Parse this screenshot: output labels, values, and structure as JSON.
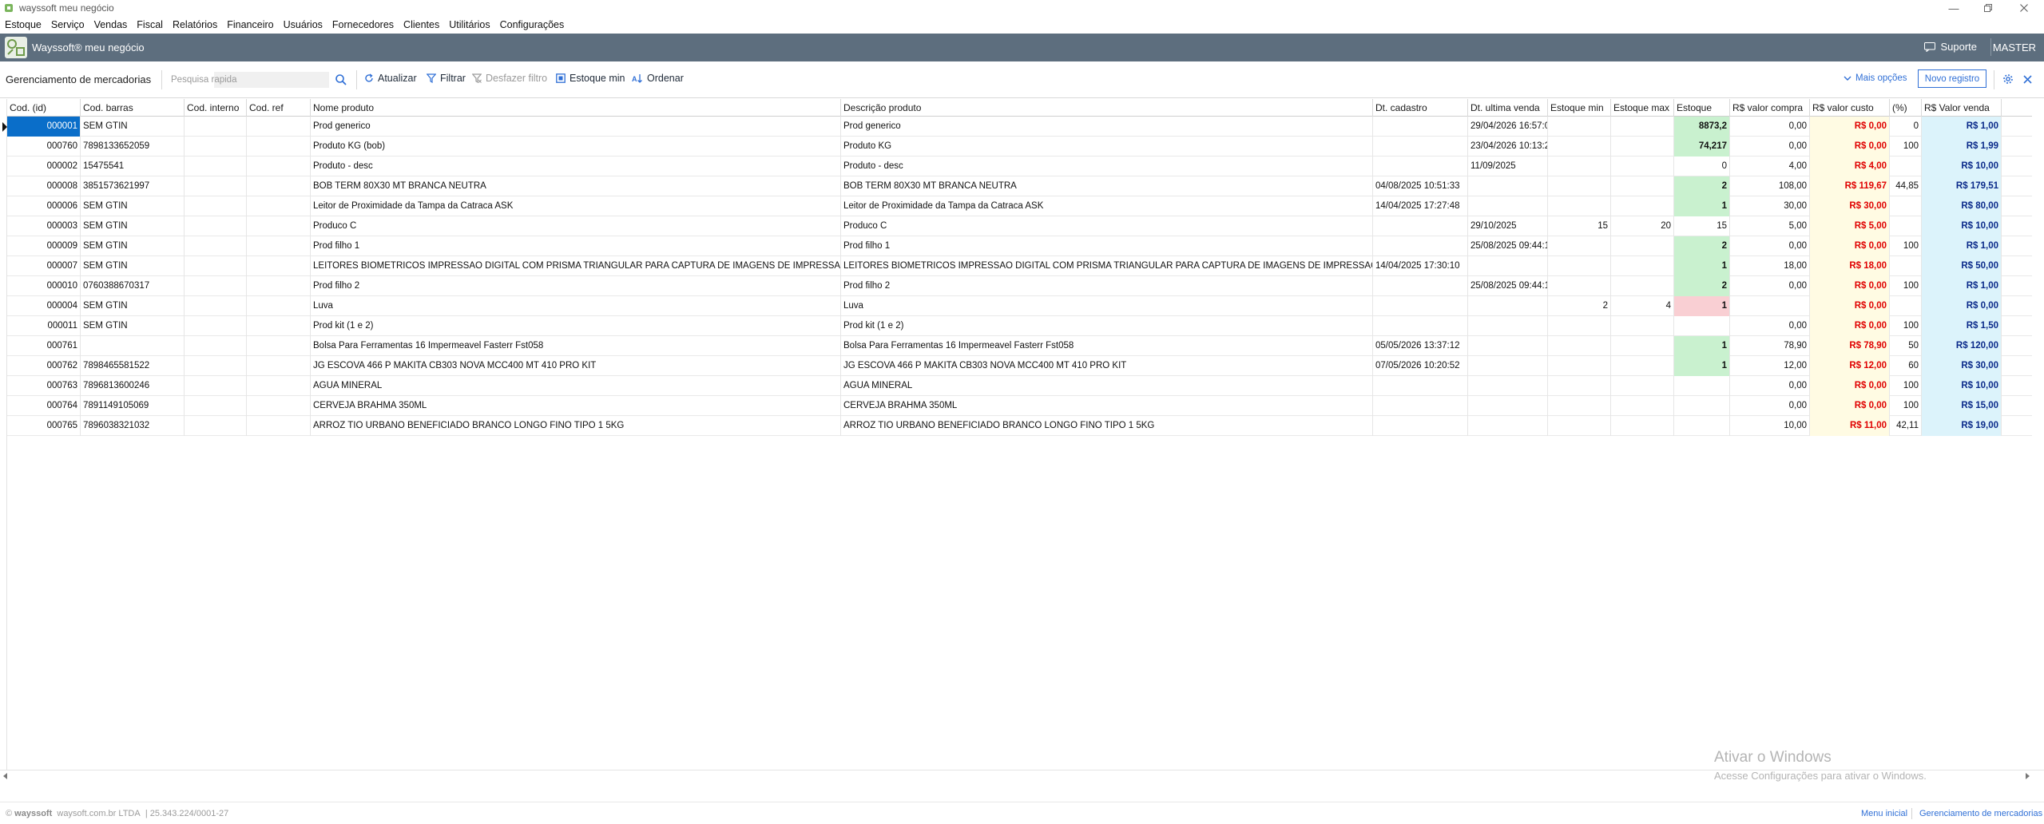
{
  "window": {
    "title": "wayssoft meu negócio"
  },
  "menu": [
    "Estoque",
    "Serviço",
    "Vendas",
    "Fiscal",
    "Relatórios",
    "Financeiro",
    "Usuários",
    "Fornecedores",
    "Clientes",
    "Utilitários",
    "Configurações"
  ],
  "brand": {
    "name": "Wayssoft® meu negócio",
    "support": "Suporte",
    "user": "MASTER"
  },
  "toolbar": {
    "page_title": "Gerenciamento de mercadorias",
    "search_placeholder": "Pesquisa rapida",
    "atualizar": "Atualizar",
    "filtrar": "Filtrar",
    "desfazer_filtro": "Desfazer filtro",
    "estoque_min": "Estoque min",
    "ordenar": "Ordenar",
    "mais_opcoes": "Mais opções",
    "novo_registro": "Novo registro"
  },
  "grid": {
    "columns": [
      "Cod. (id)",
      "Cod. barras",
      "Cod. interno",
      "Cod. ref",
      "Nome produto",
      "Descrição produto",
      "Dt. cadastro",
      "Dt. ultima venda",
      "Estoque min",
      "Estoque max",
      "Estoque",
      "R$ valor compra",
      "R$ valor custo",
      "(%)",
      "R$ Valor venda"
    ],
    "rows": [
      {
        "id": "000001",
        "barras": "SEM GTIN",
        "interno": "",
        "ref": "",
        "nome": "Prod generico",
        "desc": "Prod generico",
        "dtcad": "",
        "dtvenda": "29/04/2026 16:57:0",
        "emin": "",
        "emax": "",
        "estq": "8873,2",
        "estq_state": "pos",
        "compra": "0,00",
        "custo": "R$ 0,00",
        "perc": "0",
        "venda": "R$ 1,00"
      },
      {
        "id": "000760",
        "barras": "7898133652059",
        "interno": "",
        "ref": "",
        "nome": "Produto KG (bob)",
        "desc": "Produto KG",
        "dtcad": "",
        "dtvenda": "23/04/2026 10:13:2",
        "emin": "",
        "emax": "",
        "estq": "74,217",
        "estq_state": "pos",
        "compra": "0,00",
        "custo": "R$ 0,00",
        "perc": "100",
        "venda": "R$ 1,99"
      },
      {
        "id": "000002",
        "barras": "15475541",
        "interno": "",
        "ref": "",
        "nome": "Produto - desc",
        "desc": "Produto - desc",
        "dtcad": "",
        "dtvenda": "11/09/2025",
        "emin": "",
        "emax": "",
        "estq": "0",
        "estq_state": "none",
        "compra": "4,00",
        "custo": "R$ 4,00",
        "perc": "",
        "venda": "R$ 10,00"
      },
      {
        "id": "000008",
        "barras": "3851573621997",
        "interno": "",
        "ref": "",
        "nome": "BOB TERM 80X30 MT BRANCA  NEUTRA",
        "desc": "BOB TERM 80X30 MT BRANCA  NEUTRA",
        "dtcad": "04/08/2025 10:51:33",
        "dtvenda": "",
        "emin": "",
        "emax": "",
        "estq": "2",
        "estq_state": "pos",
        "compra": "108,00",
        "custo": "R$ 119,67",
        "perc": "44,85",
        "venda": "R$ 179,51"
      },
      {
        "id": "000006",
        "barras": "SEM GTIN",
        "interno": "",
        "ref": "",
        "nome": "Leitor de Proximidade da Tampa da Catraca ASK",
        "desc": "Leitor de Proximidade da Tampa da Catraca ASK",
        "dtcad": "14/04/2025 17:27:48",
        "dtvenda": "",
        "emin": "",
        "emax": "",
        "estq": "1",
        "estq_state": "pos",
        "compra": "30,00",
        "custo": "R$ 30,00",
        "perc": "",
        "venda": "R$ 80,00"
      },
      {
        "id": "000003",
        "barras": "SEM GTIN",
        "interno": "",
        "ref": "",
        "nome": "Produco C",
        "desc": "Produco C",
        "dtcad": "",
        "dtvenda": "29/10/2025",
        "emin": "15",
        "emax": "20",
        "estq": "15",
        "estq_state": "none",
        "compra": "5,00",
        "custo": "R$ 5,00",
        "perc": "",
        "venda": "R$ 10,00"
      },
      {
        "id": "000009",
        "barras": "SEM GTIN",
        "interno": "",
        "ref": "",
        "nome": "Prod filho 1",
        "desc": "Prod filho 1",
        "dtcad": "",
        "dtvenda": "25/08/2025 09:44:1",
        "emin": "",
        "emax": "",
        "estq": "2",
        "estq_state": "pos",
        "compra": "0,00",
        "custo": "R$ 0,00",
        "perc": "100",
        "venda": "R$ 1,00"
      },
      {
        "id": "000007",
        "barras": "SEM GTIN",
        "interno": "",
        "ref": "",
        "nome": "LEITORES BIOMETRICOS IMPRESSAO DIGITAL COM PRISMA TRIANGULAR PARA CAPTURA DE IMAGENS DE IMPRESSAO",
        "desc": "LEITORES BIOMETRICOS IMPRESSAO DIGITAL COM PRISMA TRIANGULAR PARA CAPTURA DE IMAGENS DE IMPRESSAO",
        "dtcad": "14/04/2025 17:30:10",
        "dtvenda": "",
        "emin": "",
        "emax": "",
        "estq": "1",
        "estq_state": "pos",
        "compra": "18,00",
        "custo": "R$ 18,00",
        "perc": "",
        "venda": "R$ 50,00"
      },
      {
        "id": "000010",
        "barras": "0760388670317",
        "interno": "",
        "ref": "",
        "nome": "Prod filho 2",
        "desc": "Prod filho 2",
        "dtcad": "",
        "dtvenda": "25/08/2025 09:44:1",
        "emin": "",
        "emax": "",
        "estq": "2",
        "estq_state": "pos",
        "compra": "0,00",
        "custo": "R$ 0,00",
        "perc": "100",
        "venda": "R$ 1,00"
      },
      {
        "id": "000004",
        "barras": "SEM GTIN",
        "interno": "",
        "ref": "",
        "nome": "Luva",
        "desc": "Luva",
        "dtcad": "",
        "dtvenda": "",
        "emin": "2",
        "emax": "4",
        "estq": "1",
        "estq_state": "neg",
        "compra": "",
        "custo": "R$ 0,00",
        "perc": "",
        "venda": "R$ 0,00"
      },
      {
        "id": "000011",
        "barras": "SEM GTIN",
        "interno": "",
        "ref": "",
        "nome": "Prod kit (1 e 2)",
        "desc": "Prod kit (1 e 2)",
        "dtcad": "",
        "dtvenda": "",
        "emin": "",
        "emax": "",
        "estq": "",
        "estq_state": "none",
        "compra": "0,00",
        "custo": "R$ 0,00",
        "perc": "100",
        "venda": "R$ 1,50"
      },
      {
        "id": "000761",
        "barras": "",
        "interno": "",
        "ref": "",
        "nome": "Bolsa Para Ferramentas 16 Impermeavel Fasterr Fst058",
        "desc": "Bolsa Para Ferramentas 16 Impermeavel Fasterr Fst058",
        "dtcad": "05/05/2026 13:37:12",
        "dtvenda": "",
        "emin": "",
        "emax": "",
        "estq": "1",
        "estq_state": "pos",
        "compra": "78,90",
        "custo": "R$ 78,90",
        "perc": "50",
        "venda": "R$ 120,00"
      },
      {
        "id": "000762",
        "barras": "7898465581522",
        "interno": "",
        "ref": "",
        "nome": "JG ESCOVA 466 P MAKITA CB303 NOVA MCC400 MT 410  PRO KIT",
        "desc": "JG ESCOVA 466 P MAKITA CB303 NOVA MCC400 MT 410  PRO KIT",
        "dtcad": "07/05/2026 10:20:52",
        "dtvenda": "",
        "emin": "",
        "emax": "",
        "estq": "1",
        "estq_state": "pos",
        "compra": "12,00",
        "custo": "R$ 12,00",
        "perc": "60",
        "venda": "R$ 30,00"
      },
      {
        "id": "000763",
        "barras": "7896813600246",
        "interno": "",
        "ref": "",
        "nome": "AGUA MINERAL",
        "desc": "AGUA MINERAL",
        "dtcad": "",
        "dtvenda": "",
        "emin": "",
        "emax": "",
        "estq": "",
        "estq_state": "none",
        "compra": "0,00",
        "custo": "R$ 0,00",
        "perc": "100",
        "venda": "R$ 10,00"
      },
      {
        "id": "000764",
        "barras": "7891149105069",
        "interno": "",
        "ref": "",
        "nome": "CERVEJA BRAHMA 350ML",
        "desc": "CERVEJA BRAHMA 350ML",
        "dtcad": "",
        "dtvenda": "",
        "emin": "",
        "emax": "",
        "estq": "",
        "estq_state": "none",
        "compra": "0,00",
        "custo": "R$ 0,00",
        "perc": "100",
        "venda": "R$ 15,00"
      },
      {
        "id": "000765",
        "barras": "7896038321032",
        "interno": "",
        "ref": "",
        "nome": "ARROZ TIO URBANO BENEFICIADO BRANCO LONGO FINO TIPO 1 5KG",
        "desc": "ARROZ TIO URBANO BENEFICIADO BRANCO LONGO FINO TIPO 1 5KG",
        "dtcad": "",
        "dtvenda": "",
        "emin": "",
        "emax": "",
        "estq": "",
        "estq_state": "none",
        "compra": "10,00",
        "custo": "R$ 11,00",
        "perc": "42,11",
        "venda": "R$ 19,00"
      }
    ]
  },
  "watermark": {
    "title": "Ativar o Windows",
    "subtitle": "Acesse Configurações para ativar o Windows."
  },
  "footer": {
    "brand": "wayssoft",
    "company": "waysoft.com.br LTDA",
    "cnpj": "25.343.224/0001-27",
    "link_home": "Menu inicial",
    "link_current": "Gerenciamento de mercadorias"
  },
  "colors": {
    "brand_bar": "#5d6e7e",
    "accent": "#2f6fd6",
    "selected": "#0a6ec9",
    "stock_ok": "#c9f1cf",
    "stock_low": "#f9cfd3",
    "cost_bg": "#fffbe3",
    "price_bg": "#dcf3fb"
  }
}
